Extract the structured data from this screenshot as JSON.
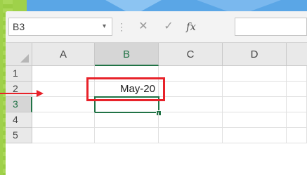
{
  "formula_bar": {
    "name_box_value": "B3",
    "name_box_arrow": "▾",
    "separator": "⋮",
    "cancel_symbol": "✕",
    "enter_symbol": "✓",
    "fx_symbol": "fx",
    "formula_value": ""
  },
  "columns": [
    "A",
    "B",
    "C",
    "D"
  ],
  "rows": [
    "1",
    "2",
    "3",
    "4",
    "5"
  ],
  "cells": {
    "B2": "May-20"
  },
  "active_cell": "B3",
  "colors": {
    "accent": "#217346",
    "highlight_red": "#e8222a"
  }
}
